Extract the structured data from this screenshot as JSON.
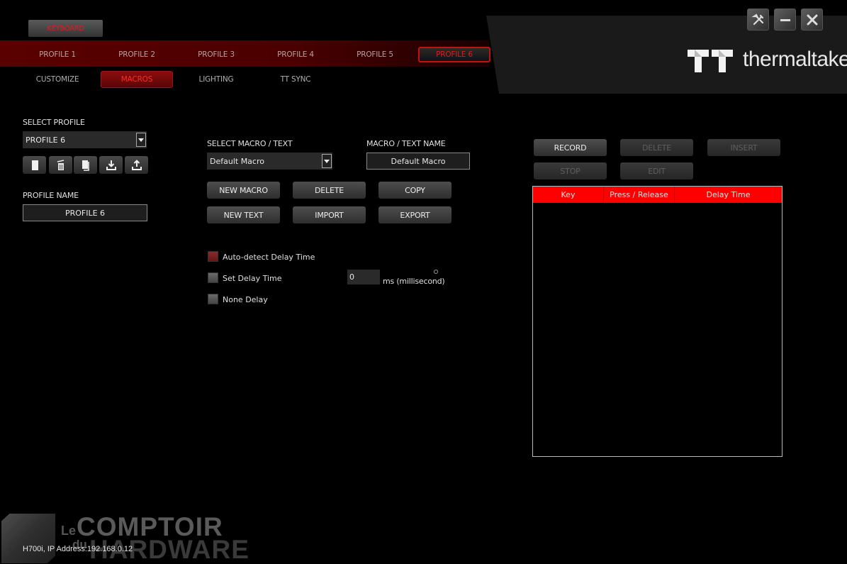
{
  "header": {
    "device_tab": "KEYBOARD",
    "profiles": [
      "PROFILE 1",
      "PROFILE 2",
      "PROFILE 3",
      "PROFILE 4",
      "PROFILE 5",
      "PROFILE 6"
    ],
    "active_profile_index": 5,
    "sub_tabs": [
      "CUSTOMIZE",
      "MACROS",
      "LIGHTING",
      "TT SYNC"
    ],
    "active_sub_tab_index": 1,
    "brand": "thermaltake",
    "window_buttons": [
      "settings-icon",
      "minimize-icon",
      "close-icon"
    ]
  },
  "profile_panel": {
    "select_label": "SELECT PROFILE",
    "selected_profile": "PROFILE 6",
    "actions": [
      "new-profile-icon",
      "delete-profile-icon",
      "copy-profile-icon",
      "import-profile-icon",
      "export-profile-icon"
    ],
    "name_label": "PROFILE NAME",
    "name_value": "PROFILE 6"
  },
  "macro_panel": {
    "select_label": "SELECT MACRO / TEXT",
    "selected_macro": "Default Macro",
    "name_label": "MACRO / TEXT NAME",
    "name_value": "Default Macro",
    "buttons": {
      "new_macro": "NEW MACRO",
      "delete": "DELETE",
      "copy": "COPY",
      "new_text": "NEW TEXT",
      "import": "IMPORT",
      "export": "EXPORT"
    },
    "delay_options": [
      {
        "label": "Auto-detect Delay Time",
        "checked": true
      },
      {
        "label": "Set Delay Time",
        "checked": false
      },
      {
        "label": "None Delay",
        "checked": false
      }
    ],
    "delay_value": "0",
    "delay_unit": "ms (millisecond)"
  },
  "record_panel": {
    "buttons": {
      "record": "RECORD",
      "delete": "DELETE",
      "insert": "INSERT",
      "stop": "STOP",
      "edit": "EDIT"
    },
    "table": {
      "columns": [
        "Key",
        "Press / Release",
        "Delay Time"
      ],
      "rows": []
    }
  },
  "watermark": {
    "le": "Le",
    "comptoir": "COMPTOIR",
    "du": "du",
    "hardware": "HARDWARE"
  },
  "status_bar": "H700i, IP Address:192.168.0.12",
  "colors": {
    "accent": "#ff0000",
    "active_text": "#e21c1c",
    "profile_bar": "#5a0000"
  }
}
